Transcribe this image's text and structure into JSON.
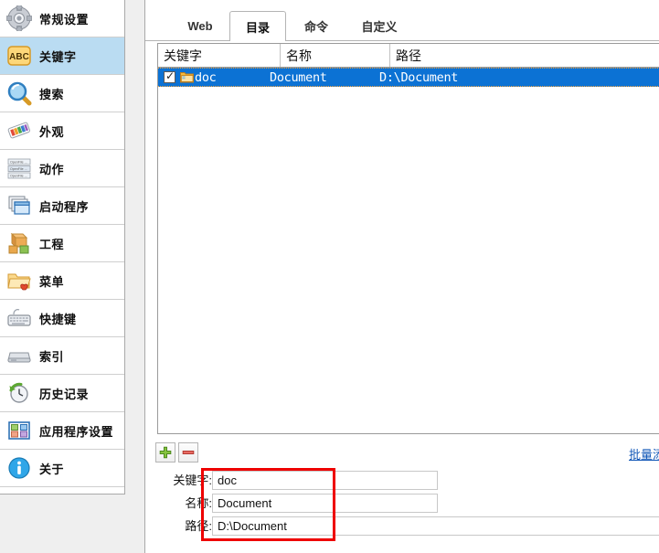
{
  "sidebar": {
    "items": [
      {
        "label": "常规设置",
        "icon": "gear-icon"
      },
      {
        "label": "关键字",
        "icon": "abc-icon",
        "selected": true
      },
      {
        "label": "搜索",
        "icon": "magnifier-icon"
      },
      {
        "label": "外观",
        "icon": "palette-icon"
      },
      {
        "label": "动作",
        "icon": "actions-list-icon"
      },
      {
        "label": "启动程序",
        "icon": "windows-stack-icon"
      },
      {
        "label": "工程",
        "icon": "blocks-icon"
      },
      {
        "label": "菜单",
        "icon": "folder-heart-icon"
      },
      {
        "label": "快捷键",
        "icon": "keyboard-icon"
      },
      {
        "label": "索引",
        "icon": "drive-icon"
      },
      {
        "label": "历史记录",
        "icon": "clock-refresh-icon"
      },
      {
        "label": "应用程序设置",
        "icon": "app-grid-icon"
      },
      {
        "label": "关于",
        "icon": "info-icon"
      }
    ]
  },
  "main": {
    "tabs": [
      {
        "label": "Web",
        "active": false
      },
      {
        "label": "目录",
        "active": true
      },
      {
        "label": "命令",
        "active": false
      },
      {
        "label": "自定义",
        "active": false
      }
    ],
    "table": {
      "columns": [
        "关键字",
        "名称",
        "路径"
      ],
      "rows": [
        {
          "checked": true,
          "icon": "folder-icon",
          "keyword": "doc",
          "name": "Document",
          "path": "D:\\Document",
          "selected": true
        }
      ]
    },
    "toolbar": {
      "add_label": "+",
      "remove_label": "−",
      "batch_link": "批量添加"
    },
    "form": {
      "keyword_label": "关键字:",
      "keyword_value": "doc",
      "keyword_placeholder": "",
      "name_label": "名称:",
      "name_value": "Document",
      "name_placeholder": "",
      "path_label": "路径:",
      "path_value": "D:\\Document",
      "path_placeholder": ""
    }
  },
  "colors": {
    "selection_blue": "#0c72d4",
    "sidebar_selected": "#badcf2",
    "link_blue": "#1157b7",
    "annotation_red": "#ee0000",
    "focus_dotted": "#f2a33c"
  }
}
